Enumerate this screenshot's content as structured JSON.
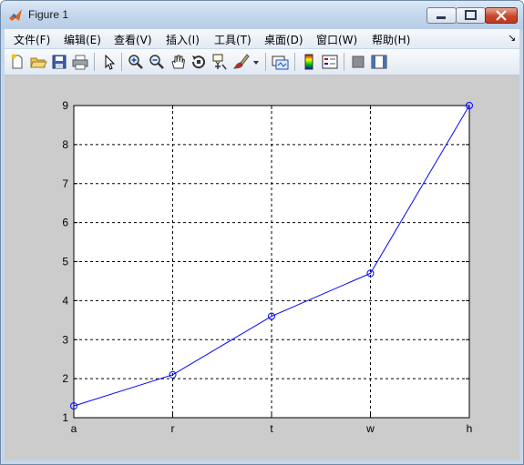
{
  "window": {
    "title": "Figure 1"
  },
  "menu": {
    "items": [
      {
        "label": "文件(F)",
        "name": "menu-file"
      },
      {
        "label": "编辑(E)",
        "name": "menu-edit"
      },
      {
        "label": "查看(V)",
        "name": "menu-view"
      },
      {
        "label": "插入(I)",
        "name": "menu-insert"
      },
      {
        "label": "工具(T)",
        "name": "menu-tools"
      },
      {
        "label": "桌面(D)",
        "name": "menu-desktop"
      },
      {
        "label": "窗口(W)",
        "name": "menu-window"
      },
      {
        "label": "帮助(H)",
        "name": "menu-help"
      }
    ]
  },
  "toolbar": {
    "icons": [
      "new-figure-icon",
      "open-file-icon",
      "save-icon",
      "print-icon",
      "select-arrow-icon",
      "zoom-in-icon",
      "zoom-out-icon",
      "pan-hand-icon",
      "rotate-3d-icon",
      "data-cursor-icon",
      "brush-icon",
      "brush-dropdown-icon",
      "link-plot-icon",
      "colorbar-icon",
      "legend-icon",
      "hide-plot-tools-icon",
      "show-plot-tools-icon"
    ]
  },
  "colors": {
    "line": "#0000ff",
    "grid": "#000000",
    "figure_bg": "#cccccc",
    "axes_bg": "#ffffff"
  },
  "chart_data": {
    "type": "line",
    "categories": [
      "a",
      "r",
      "t",
      "w",
      "h"
    ],
    "values": [
      1.3,
      2.1,
      3.6,
      4.7,
      9.0
    ],
    "marker": "circle",
    "ylim": [
      1,
      9
    ],
    "yticks": [
      1,
      2,
      3,
      4,
      5,
      6,
      7,
      8,
      9
    ],
    "grid": true,
    "grid_style": "dashed"
  }
}
